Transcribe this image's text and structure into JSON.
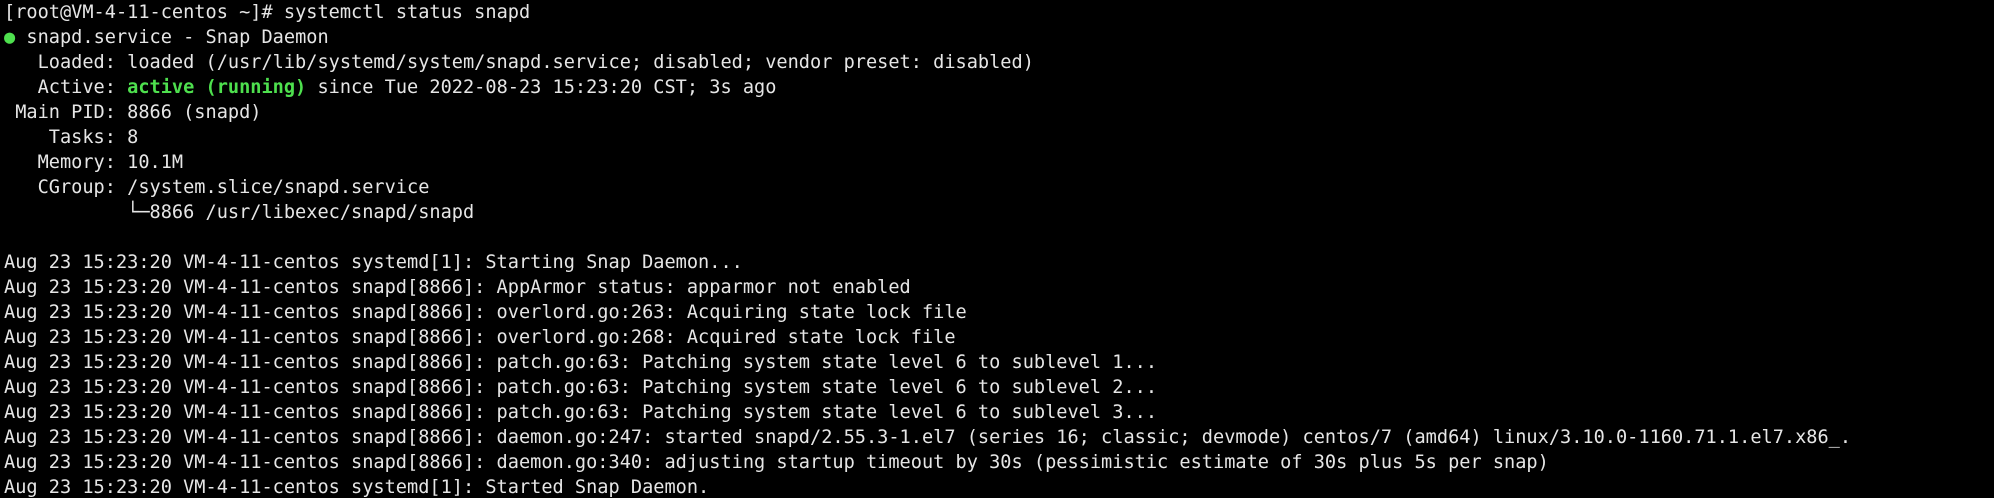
{
  "prompt": "[root@VM-4-11-centos ~]# ",
  "command": "systemctl status snapd",
  "status": {
    "dot": "●",
    "unit_title": " snapd.service - Snap Daemon",
    "loaded_label": "   Loaded: ",
    "loaded_value": "loaded (/usr/lib/systemd/system/snapd.service; disabled; vendor preset: disabled)",
    "active_label": "   Active: ",
    "active_state": "active (running)",
    "active_since": " since Tue 2022-08-23 15:23:20 CST; 3s ago",
    "mainpid_label": " Main PID: ",
    "mainpid_value": "8866 (snapd)",
    "tasks_label": "    Tasks: ",
    "tasks_value": "8",
    "memory_label": "   Memory: ",
    "memory_value": "10.1M",
    "cgroup_label": "   CGroup: ",
    "cgroup_value": "/system.slice/snapd.service",
    "cgroup_child": "           └─8866 /usr/libexec/snapd/snapd"
  },
  "log": [
    "Aug 23 15:23:20 VM-4-11-centos systemd[1]: Starting Snap Daemon...",
    "Aug 23 15:23:20 VM-4-11-centos snapd[8866]: AppArmor status: apparmor not enabled",
    "Aug 23 15:23:20 VM-4-11-centos snapd[8866]: overlord.go:263: Acquiring state lock file",
    "Aug 23 15:23:20 VM-4-11-centos snapd[8866]: overlord.go:268: Acquired state lock file",
    "Aug 23 15:23:20 VM-4-11-centos snapd[8866]: patch.go:63: Patching system state level 6 to sublevel 1...",
    "Aug 23 15:23:20 VM-4-11-centos snapd[8866]: patch.go:63: Patching system state level 6 to sublevel 2...",
    "Aug 23 15:23:20 VM-4-11-centos snapd[8866]: patch.go:63: Patching system state level 6 to sublevel 3...",
    "Aug 23 15:23:20 VM-4-11-centos snapd[8866]: daemon.go:247: started snapd/2.55.3-1.el7 (series 16; classic; devmode) centos/7 (amd64) linux/3.10.0-1160.71.1.el7.x86_.",
    "Aug 23 15:23:20 VM-4-11-centos snapd[8866]: daemon.go:340: adjusting startup timeout by 30s (pessimistic estimate of 30s plus 5s per snap)",
    "Aug 23 15:23:20 VM-4-11-centos systemd[1]: Started Snap Daemon."
  ],
  "colors": {
    "background": "#000000",
    "foreground": "#e6e6e6",
    "active_green": "#4ee04e"
  }
}
